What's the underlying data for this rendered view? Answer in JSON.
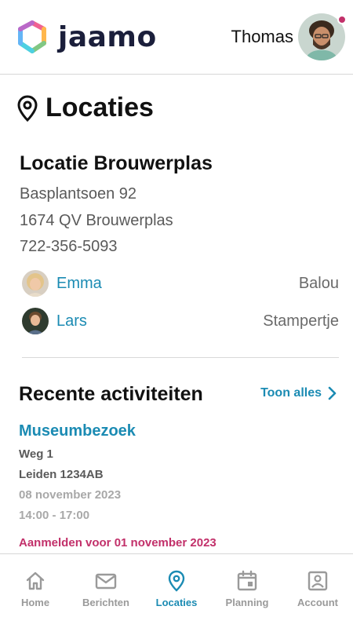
{
  "header": {
    "brand_name": "jaamo",
    "user_name": "Thomas"
  },
  "page": {
    "title": "Locaties"
  },
  "location": {
    "name": "Locatie Brouwerplas",
    "street": "Basplantsoen 92",
    "postal_city": "1674 QV Brouwerplas",
    "phone": "722-356-5093",
    "children": [
      {
        "name": "Emma",
        "group": "Balou"
      },
      {
        "name": "Lars",
        "group": "Stampertje"
      }
    ]
  },
  "recent": {
    "title": "Recente activiteiten",
    "see_all_label": "Toon alles",
    "activity": {
      "title": "Museumbezoek",
      "address_line1": "Weg 1",
      "address_line2": "Leiden 1234AB",
      "date": "08 november 2023",
      "time": "14:00 - 17:00",
      "register_by": "Aanmelden voor 01 november 2023"
    }
  },
  "nav": {
    "items": [
      {
        "label": "Home",
        "icon": "home-icon",
        "active": false
      },
      {
        "label": "Berichten",
        "icon": "mail-icon",
        "active": false
      },
      {
        "label": "Locaties",
        "icon": "location-pin-icon",
        "active": true
      },
      {
        "label": "Planning",
        "icon": "calendar-icon",
        "active": false
      },
      {
        "label": "Account",
        "icon": "account-icon",
        "active": false
      }
    ]
  },
  "colors": {
    "accent": "#1b8bb3",
    "alert": "#c2306a",
    "muted": "#9a9a9a",
    "brand_dark": "#1b1f3b"
  }
}
